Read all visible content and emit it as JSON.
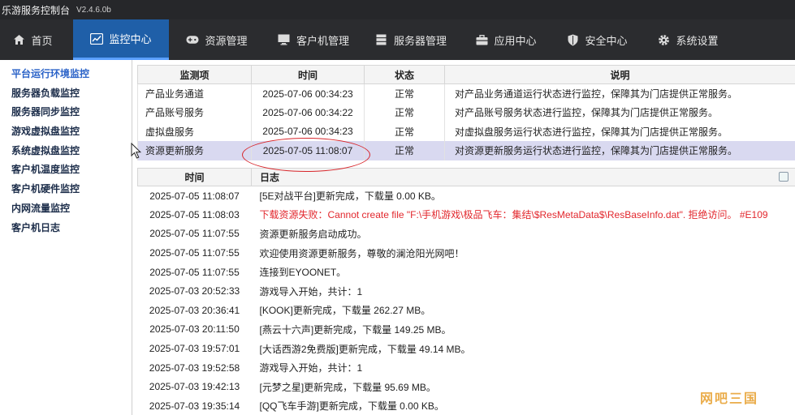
{
  "window": {
    "title": "乐游服务控制台",
    "version": "V2.4.6.0b"
  },
  "nav": {
    "items": [
      {
        "label": "首页",
        "icon": "home-icon"
      },
      {
        "label": "监控中心",
        "icon": "monitor-chart-icon",
        "active": true
      },
      {
        "label": "资源管理",
        "icon": "gamepad-icon"
      },
      {
        "label": "客户机管理",
        "icon": "desktop-icon"
      },
      {
        "label": "服务器管理",
        "icon": "server-icon"
      },
      {
        "label": "应用中心",
        "icon": "briefcase-icon"
      },
      {
        "label": "安全中心",
        "icon": "shield-icon"
      },
      {
        "label": "系统设置",
        "icon": "gear-icon"
      }
    ]
  },
  "sidebar": {
    "items": [
      {
        "label": "平台运行环境监控",
        "active": true
      },
      {
        "label": "服务器负载监控"
      },
      {
        "label": "服务器同步监控"
      },
      {
        "label": "游戏虚拟盘监控"
      },
      {
        "label": "系统虚拟盘监控"
      },
      {
        "label": "客户机温度监控"
      },
      {
        "label": "客户机硬件监控"
      },
      {
        "label": "内网流量监控"
      },
      {
        "label": "客户机日志"
      }
    ]
  },
  "status_table": {
    "headers": [
      "监测项",
      "时间",
      "状态",
      "说明"
    ],
    "rows": [
      {
        "name": "产品业务通道",
        "time": "2025-07-06 00:34:23",
        "state": "正常",
        "desc": "对产品业务通道运行状态进行监控，保障其为门店提供正常服务。"
      },
      {
        "name": "产品账号服务",
        "time": "2025-07-06 00:34:22",
        "state": "正常",
        "desc": "对产品账号服务状态进行监控，保障其为门店提供正常服务。"
      },
      {
        "name": "虚拟盘服务",
        "time": "2025-07-06 00:34:23",
        "state": "正常",
        "desc": "对虚拟盘服务运行状态进行监控，保障其为门店提供正常服务。"
      },
      {
        "name": "资源更新服务",
        "time": "2025-07-05 11:08:07",
        "state": "正常",
        "desc": "对资源更新服务运行状态进行监控，保障其为门店提供正常服务。",
        "selected": true
      }
    ]
  },
  "log_table": {
    "headers": [
      "时间",
      "日志"
    ],
    "rows": [
      {
        "time": "2025-07-05 11:08:07",
        "msg": "[5E对战平台]更新完成，下载量 0.00 KB。"
      },
      {
        "time": "2025-07-05 11:08:03",
        "msg": "下载资源失败：Cannot create file \"F:\\手机游戏\\极品飞车：集结\\$ResMetaData$\\ResBaseInfo.dat\". 拒绝访问。 #E109",
        "error": true
      },
      {
        "time": "2025-07-05 11:07:55",
        "msg": "资源更新服务启动成功。"
      },
      {
        "time": "2025-07-05 11:07:55",
        "msg": "欢迎使用资源更新服务，尊敬的澜沧阳光网吧！"
      },
      {
        "time": "2025-07-05 11:07:55",
        "msg": "连接到EYOONET。"
      },
      {
        "time": "2025-07-03 20:52:33",
        "msg": "游戏导入开始，共计：1"
      },
      {
        "time": "2025-07-03 20:36:41",
        "msg": "[KOOK]更新完成，下载量 262.27 MB。"
      },
      {
        "time": "2025-07-03 20:11:50",
        "msg": "[燕云十六声]更新完成，下载量 149.25 MB。"
      },
      {
        "time": "2025-07-03 19:57:01",
        "msg": "[大话西游2免费版]更新完成，下载量 49.14 MB。"
      },
      {
        "time": "2025-07-03 19:52:58",
        "msg": "游戏导入开始，共计：1"
      },
      {
        "time": "2025-07-03 19:42:13",
        "msg": "[元梦之星]更新完成，下载量 95.69 MB。"
      },
      {
        "time": "2025-07-03 19:35:14",
        "msg": "[QQ飞车手游]更新完成，下载量 0.00 KB。"
      }
    ]
  },
  "watermark": {
    "text": "网吧三国"
  },
  "colors": {
    "nav_active": "#1f5fa8",
    "sidebar_active": "#2b63c8",
    "error_text": "#e2272d",
    "selected_row": "#d9d9f0",
    "annotation": "#d8262b"
  }
}
